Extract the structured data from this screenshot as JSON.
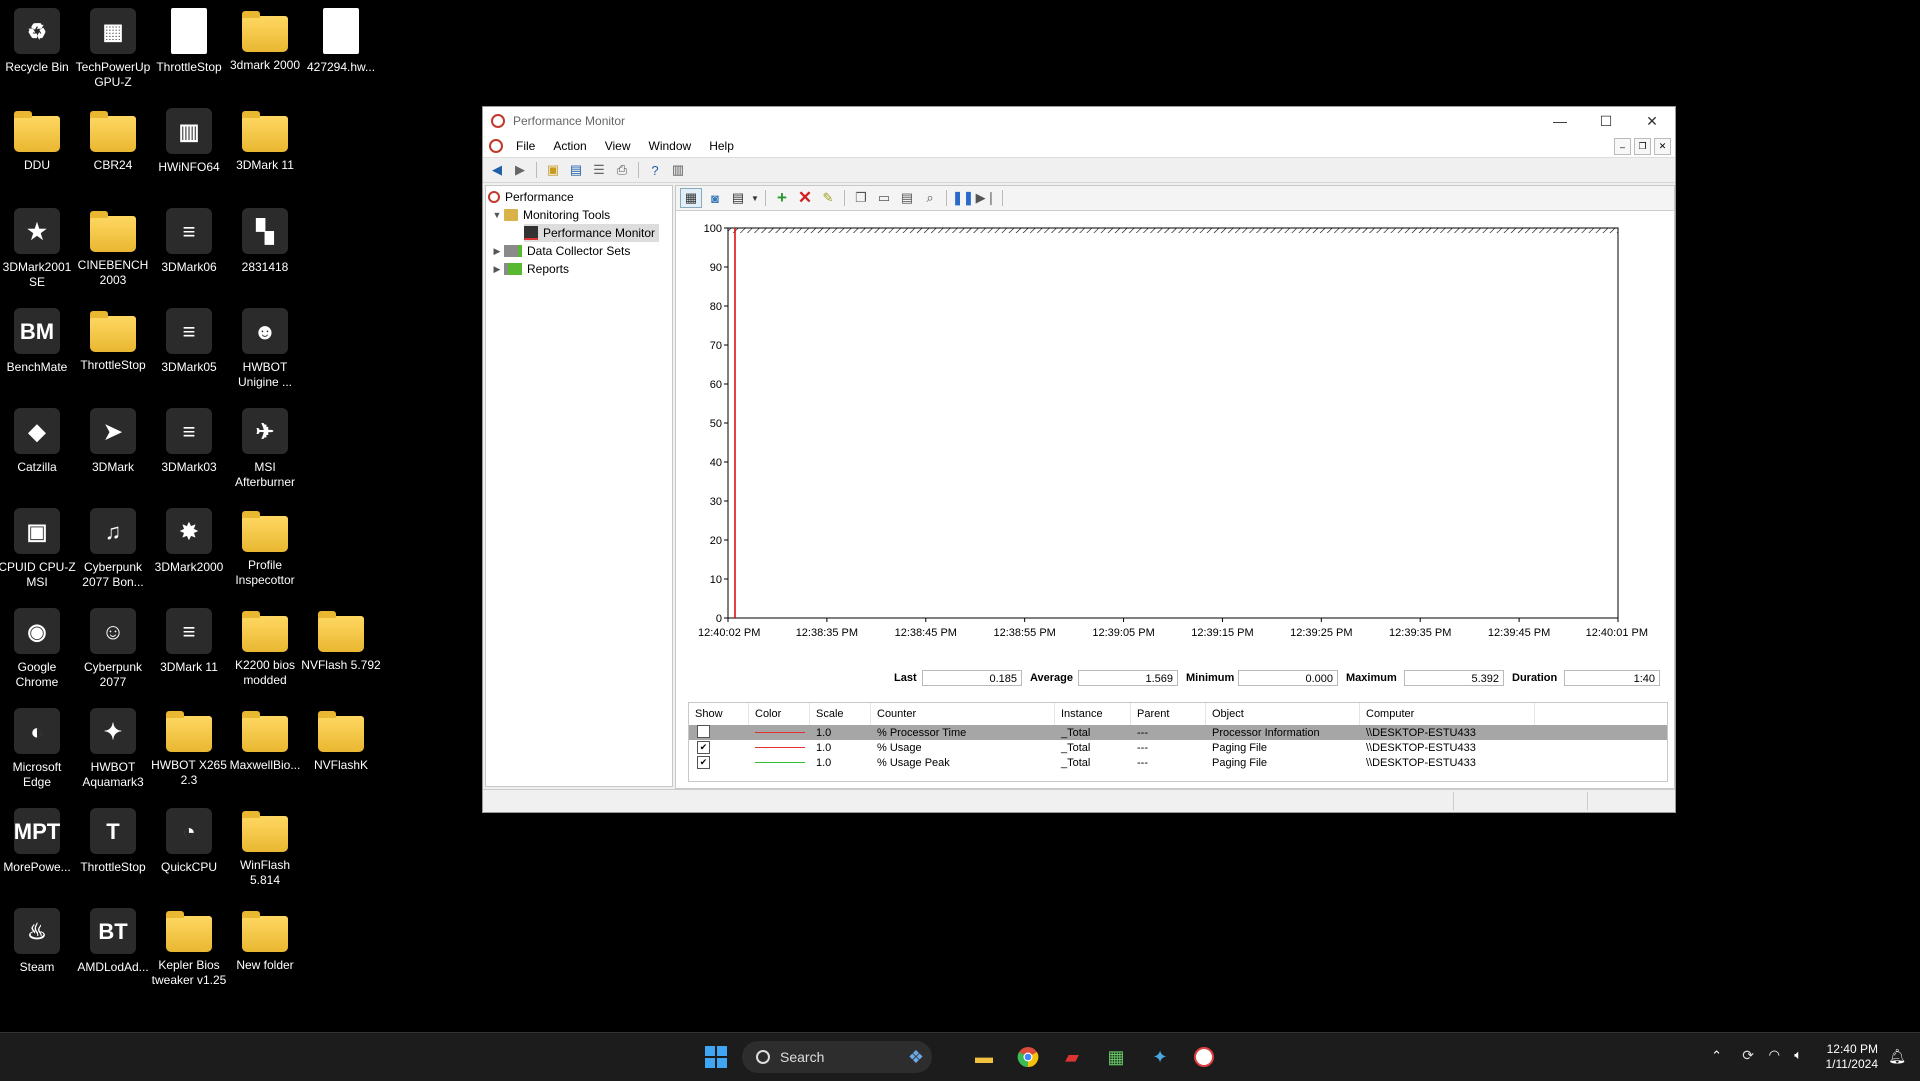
{
  "desktop": {
    "icons": [
      {
        "label": "Recycle Bin",
        "kind": "app",
        "glyph": "♻"
      },
      {
        "label": "TechPowerUp GPU-Z",
        "kind": "app",
        "glyph": "▦"
      },
      {
        "label": "ThrottleStop",
        "kind": "file",
        "glyph": "⚙"
      },
      {
        "label": "3dmark 2000",
        "kind": "folder",
        "glyph": ""
      },
      {
        "label": "427294.hw...",
        "kind": "file",
        "glyph": ""
      },
      {
        "label": "DDU",
        "kind": "folder",
        "glyph": ""
      },
      {
        "label": "CBR24",
        "kind": "folder",
        "glyph": ""
      },
      {
        "label": "HWiNFO64",
        "kind": "app",
        "glyph": "▥"
      },
      {
        "label": "3DMark 11",
        "kind": "folder",
        "glyph": ""
      },
      {
        "label": "3DMark2001 SE",
        "kind": "app",
        "glyph": "★"
      },
      {
        "label": "CINEBENCH 2003",
        "kind": "folder",
        "glyph": ""
      },
      {
        "label": "3DMark06",
        "kind": "app",
        "glyph": "≡"
      },
      {
        "label": "2831418",
        "kind": "app",
        "glyph": "▚"
      },
      {
        "label": "BenchMate",
        "kind": "app",
        "glyph": "BM"
      },
      {
        "label": "ThrottleStop",
        "kind": "folder",
        "glyph": ""
      },
      {
        "label": "3DMark05",
        "kind": "app",
        "glyph": "≡"
      },
      {
        "label": "HWBOT Unigine ...",
        "kind": "app",
        "glyph": "☻"
      },
      {
        "label": "Catzilla",
        "kind": "app",
        "glyph": "◆"
      },
      {
        "label": "3DMark",
        "kind": "app",
        "glyph": "➤"
      },
      {
        "label": "3DMark03",
        "kind": "app",
        "glyph": "≡"
      },
      {
        "label": "MSI Afterburner",
        "kind": "app",
        "glyph": "✈"
      },
      {
        "label": "CPUID CPU-Z MSI",
        "kind": "app",
        "glyph": "▣"
      },
      {
        "label": "Cyberpunk 2077 Bon...",
        "kind": "app",
        "glyph": "♫"
      },
      {
        "label": "3DMark2000",
        "kind": "app",
        "glyph": "✸"
      },
      {
        "label": "Profile Inspecottor",
        "kind": "folder",
        "glyph": ""
      },
      {
        "label": "Google Chrome",
        "kind": "app",
        "glyph": "◉"
      },
      {
        "label": "Cyberpunk 2077",
        "kind": "app",
        "glyph": "☺"
      },
      {
        "label": "3DMark 11",
        "kind": "app",
        "glyph": "≡"
      },
      {
        "label": "K2200 bios modded",
        "kind": "folder",
        "glyph": ""
      },
      {
        "label": "NVFlash 5.792",
        "kind": "folder",
        "glyph": ""
      },
      {
        "label": "Microsoft Edge",
        "kind": "app",
        "glyph": "◐"
      },
      {
        "label": "HWBOT Aquamark3",
        "kind": "app",
        "glyph": "✦"
      },
      {
        "label": "HWBOT X265 2.3",
        "kind": "folder",
        "glyph": ""
      },
      {
        "label": "MaxwellBio...",
        "kind": "folder",
        "glyph": ""
      },
      {
        "label": "NVFlashK",
        "kind": "folder",
        "glyph": ""
      },
      {
        "label": "MorePowe...",
        "kind": "app",
        "glyph": "MPT"
      },
      {
        "label": "ThrottleStop",
        "kind": "app",
        "glyph": "T"
      },
      {
        "label": "QuickCPU",
        "kind": "app",
        "glyph": "◔"
      },
      {
        "label": "WinFlash 5.814",
        "kind": "folder",
        "glyph": ""
      },
      {
        "label": "Steam",
        "kind": "app",
        "glyph": "♨"
      },
      {
        "label": "AMDLodAd...",
        "kind": "app",
        "glyph": "BT"
      },
      {
        "label": "Kepler Bios tweaker v1.25",
        "kind": "folder",
        "glyph": ""
      },
      {
        "label": "New folder",
        "kind": "folder",
        "glyph": ""
      }
    ]
  },
  "window": {
    "title": "Performance Monitor",
    "menu": [
      "File",
      "Action",
      "View",
      "Window",
      "Help"
    ],
    "tree": {
      "root": "Performance",
      "monitoring_tools": "Monitoring Tools",
      "performance_monitor": "Performance Monitor",
      "data_collector_sets": "Data Collector Sets",
      "reports": "Reports"
    },
    "stats": {
      "last_label": "Last",
      "last": "0.185",
      "average_label": "Average",
      "average": "1.569",
      "minimum_label": "Minimum",
      "minimum": "0.000",
      "maximum_label": "Maximum",
      "maximum": "5.392",
      "duration_label": "Duration",
      "duration": "1:40"
    },
    "legend": {
      "headers": [
        "Show",
        "Color",
        "Scale",
        "Counter",
        "Instance",
        "Parent",
        "Object",
        "Computer"
      ],
      "rows": [
        {
          "show": false,
          "color": "#e03030",
          "scale": "1.0",
          "counter": "% Processor Time",
          "instance": "_Total",
          "parent": "---",
          "object": "Processor Information",
          "computer": "\\\\DESKTOP-ESTU433",
          "selected": true
        },
        {
          "show": true,
          "color": "#e03030",
          "scale": "1.0",
          "counter": "% Usage",
          "instance": "_Total",
          "parent": "---",
          "object": "Paging File",
          "computer": "\\\\DESKTOP-ESTU433",
          "selected": false
        },
        {
          "show": true,
          "color": "#30c030",
          "scale": "1.0",
          "counter": "% Usage Peak",
          "instance": "_Total",
          "parent": "---",
          "object": "Paging File",
          "computer": "\\\\DESKTOP-ESTU433",
          "selected": false
        }
      ]
    }
  },
  "chart_data": {
    "type": "line",
    "ylim": [
      0,
      100
    ],
    "yticks": [
      0,
      10,
      20,
      30,
      40,
      50,
      60,
      70,
      80,
      90,
      100
    ],
    "xticks": [
      "12:40:02 PM",
      "12:38:35 PM",
      "12:38:45 PM",
      "12:38:55 PM",
      "12:39:05 PM",
      "12:39:15 PM",
      "12:39:25 PM",
      "12:39:35 PM",
      "12:39:45 PM",
      "12:40:01 PM"
    ],
    "cursor_color": "#e00000",
    "series": []
  },
  "taskbar": {
    "search_placeholder": "Search",
    "time": "12:40 PM",
    "date": "1/11/2024"
  }
}
